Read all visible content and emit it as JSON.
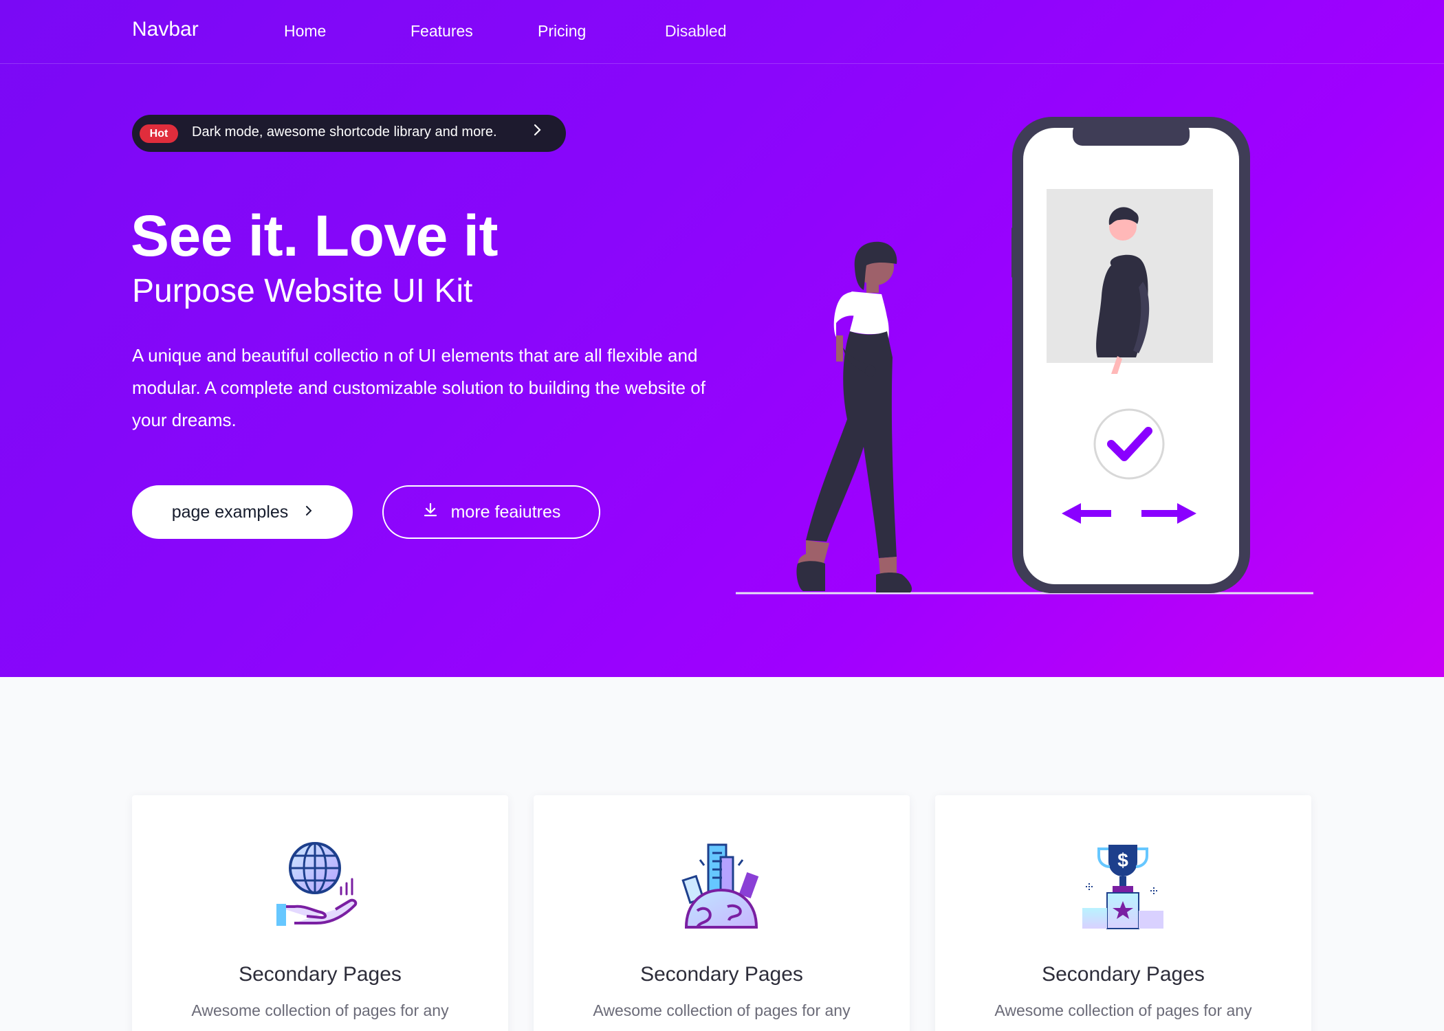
{
  "navbar": {
    "brand": "Navbar",
    "links": [
      "Home",
      "Features",
      "Pricing",
      "Disabled"
    ]
  },
  "announcement": {
    "badge": "Hot",
    "text": "Dark mode, awesome shortcode library and more.",
    "icon": "chevron-right-icon"
  },
  "hero": {
    "title": "See it. Love it",
    "subtitle": "Purpose Website UI Kit",
    "description": "A unique and beautiful collectio n of UI elements that are all flexible and modular. A complete and customizable solution to building the website of your dreams.",
    "primary_button": "page examples",
    "secondary_button": "more feaiutres"
  },
  "cards": [
    {
      "icon": "globe-hand-icon",
      "title": "Secondary Pages",
      "text": "Awesome collection of pages for any"
    },
    {
      "icon": "city-globe-icon",
      "title": "Secondary Pages",
      "text": "Awesome collection of pages for any"
    },
    {
      "icon": "trophy-podium-icon",
      "title": "Secondary Pages",
      "text": "Awesome collection of pages for any"
    }
  ],
  "colors": {
    "hero_gradient_start": "#7a09f5",
    "hero_gradient_end": "#c800f5",
    "accent": "#8a00ff",
    "badge_red": "#e02d3c",
    "pill_dark": "#1d1a2e",
    "page_background": "#f9fafc"
  }
}
